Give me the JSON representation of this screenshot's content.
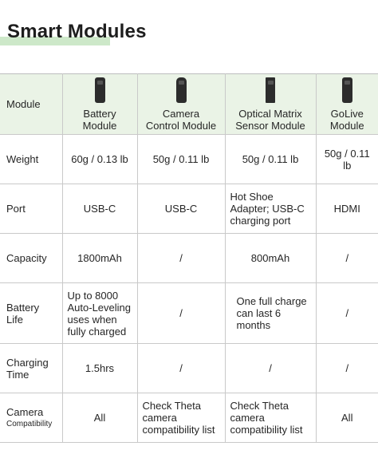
{
  "title": "Smart Modules",
  "header": {
    "label": "Module",
    "modules": [
      {
        "name_line1": "Battery",
        "name_line2": "Module",
        "icon": "battery-module-icon"
      },
      {
        "name_line1": "Camera",
        "name_line2": "Control Module",
        "icon": "camera-control-module-icon"
      },
      {
        "name_line1": "Optical Matrix",
        "name_line2": "Sensor Module",
        "icon": "optical-matrix-sensor-module-icon"
      },
      {
        "name_line1": "GoLive",
        "name_line2": "Module",
        "icon": "golive-module-icon"
      }
    ]
  },
  "rows": [
    {
      "label": "Weight",
      "cells": [
        "60g / 0.13 lb",
        "50g / 0.11 lb",
        "50g / 0.11 lb",
        "50g / 0.11 lb"
      ]
    },
    {
      "label": "Port",
      "cells": [
        "USB-C",
        "USB-C",
        "Hot Shoe Adapter; USB-C charging port",
        "HDMI"
      ]
    },
    {
      "label": "Capacity",
      "cells": [
        "1800mAh",
        "/",
        "800mAh",
        "/"
      ]
    },
    {
      "label_line1": "Battery",
      "label_line2": "Life",
      "cells": [
        "Up to 8000 Auto-Leveling uses when fully charged",
        "/",
        "One full charge can last 6 months",
        "/"
      ]
    },
    {
      "label_line1": "Charging",
      "label_line2": "Time",
      "cells": [
        "1.5hrs",
        "/",
        "/",
        "/"
      ]
    },
    {
      "label_line1": "Camera",
      "label_line2": "Compatibility",
      "cells": [
        "All",
        "Check Theta camera compatibility list",
        "Check Theta camera compatibility list",
        "All"
      ]
    }
  ]
}
